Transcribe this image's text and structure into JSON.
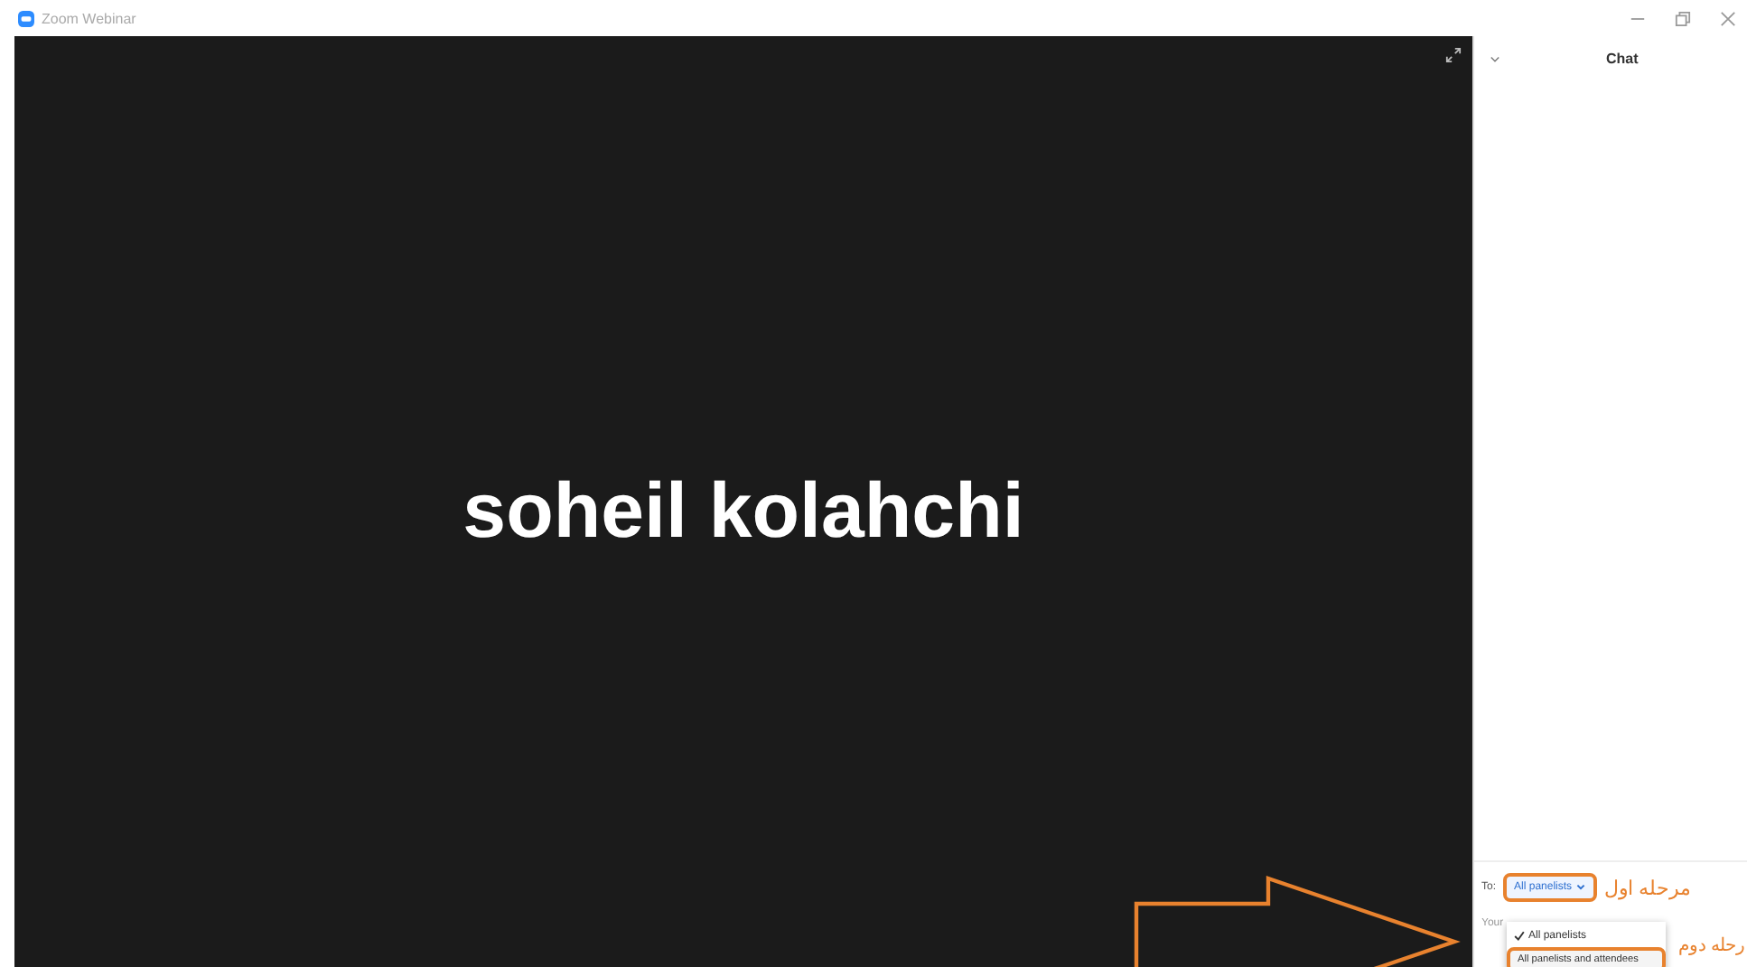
{
  "window": {
    "title": "Zoom Webinar"
  },
  "video": {
    "name": "soheil kolahchi"
  },
  "chat": {
    "title": "Chat",
    "to_label": "To:",
    "recipient": "All panelists",
    "placeholder": "Your",
    "menu": [
      {
        "label": "All panelists",
        "selected": true
      },
      {
        "label": "All panelists and attendees",
        "selected": false
      }
    ]
  },
  "annotations": [
    {
      "text": "مرحله اول"
    },
    {
      "text": "رحله دوم"
    }
  ]
}
